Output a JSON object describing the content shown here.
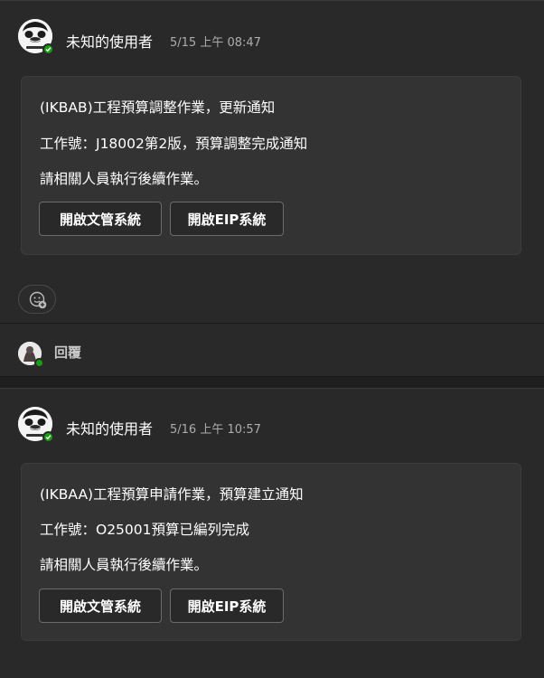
{
  "messages": [
    {
      "sender": "未知的使用者",
      "timestamp": "5/15 上午 08:47",
      "lines": [
        "(IKBAB)工程預算調整作業，更新通知",
        "工作號：J18002第2版，預算調整完成通知",
        "請相關人員執行後續作業。"
      ],
      "buttons": [
        "開啟文管系統",
        "開啟EIP系統"
      ]
    },
    {
      "sender": "未知的使用者",
      "timestamp": "5/16 上午 10:57",
      "lines": [
        "(IKBAA)工程預算申請作業，預算建立通知",
        "工作號：O25001預算已編列完成",
        "請相關人員執行後續作業。"
      ],
      "buttons": [
        "開啟文管系統",
        "開啟EIP系統"
      ]
    }
  ],
  "reply": {
    "label": "回覆"
  },
  "icons": {
    "avatar": "meme-face-avatar-icon",
    "presence": "available-check-icon",
    "reaction": "add-reaction-icon"
  },
  "colors": {
    "background": "#292929",
    "card": "#333333",
    "presence": "#13a10e"
  }
}
